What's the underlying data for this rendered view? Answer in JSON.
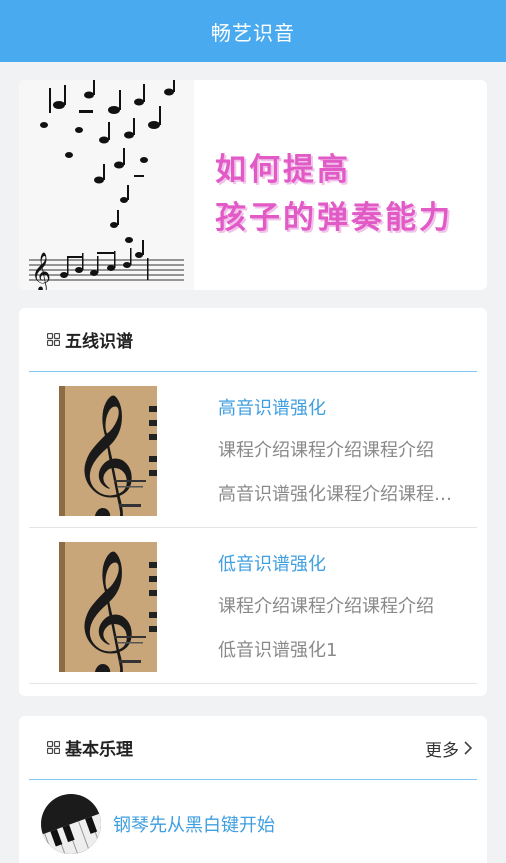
{
  "header": {
    "title": "畅艺识音"
  },
  "banner": {
    "line1": "如何提高",
    "line2": "孩子的弹奏能力"
  },
  "section_staff": {
    "title": "五线识谱",
    "courses": [
      {
        "title": "高音识谱强化",
        "desc": "课程介绍课程介绍课程介绍",
        "sub": "高音识谱强化课程介绍课程介绍"
      },
      {
        "title": "低音识谱强化",
        "desc": "课程介绍课程介绍课程介绍",
        "sub": "低音识谱强化1"
      }
    ]
  },
  "section_theory": {
    "title": "基本乐理",
    "more": "更多",
    "lessons": [
      {
        "title": "钢琴先从黑白键开始"
      }
    ]
  },
  "colors": {
    "accent": "#49aaf0",
    "link": "#3f9fe0",
    "banner_text": "#e15ac6"
  }
}
